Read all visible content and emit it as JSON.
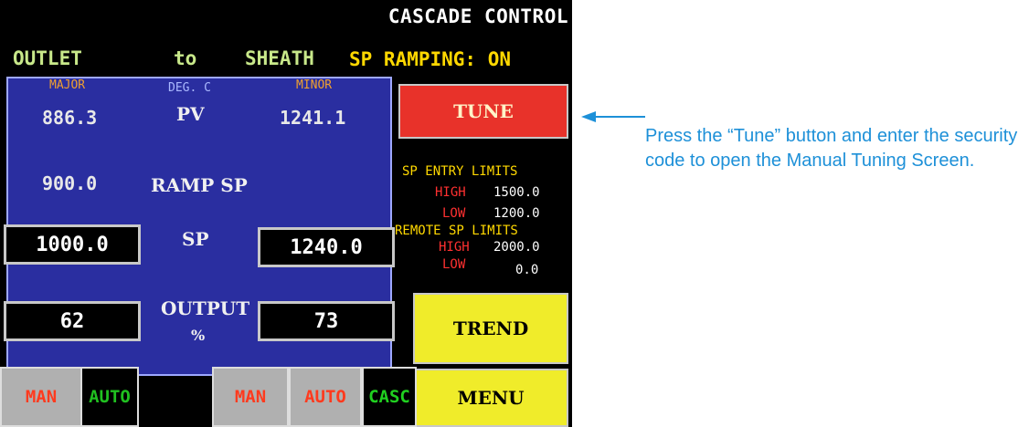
{
  "header": {
    "title": "CASCADE CONTROL",
    "outlet": "OUTLET",
    "to": "to",
    "sheath": "SHEATH",
    "sp_ramping": "SP RAMPING: ON"
  },
  "panel": {
    "major_label": "MAJOR",
    "units_label": "DEG. C",
    "minor_label": "MINOR",
    "pv_label": "PV",
    "major_pv": "886.3",
    "minor_pv": "1241.1",
    "major_ramp_sp": "900.0",
    "ramp_sp_label": "RAMP SP",
    "sp_label": "SP",
    "major_sp": "1000.0",
    "minor_sp": "1240.0",
    "output_label": "OUTPUT",
    "output_unit": "%",
    "major_output": "62",
    "minor_output": "73"
  },
  "tune_button": "TUNE",
  "sp_entry_limits": {
    "title": "SP ENTRY LIMITS",
    "high_label": "HIGH",
    "high": "1500.0",
    "low_label": "LOW",
    "low": "1200.0"
  },
  "remote_sp_limits": {
    "title": "REMOTE SP LIMITS",
    "high_label": "HIGH",
    "high": "2000.0",
    "low_label": "LOW",
    "low": "0.0"
  },
  "trend_button": "TREND",
  "menu_button": "MENU",
  "mode_buttons": {
    "major_man": "MAN",
    "major_auto": "AUTO",
    "minor_man": "MAN",
    "minor_auto": "AUTO",
    "minor_casc": "CASC"
  },
  "callout": {
    "text": "Press the “Tune” button and enter the security code to open the Manual Tuning Screen."
  },
  "colors": {
    "panel_blue": "#2a2ea0",
    "tune_red": "#e8322a",
    "button_yellow": "#f0ec2a",
    "callout_blue": "#1d90d8"
  }
}
